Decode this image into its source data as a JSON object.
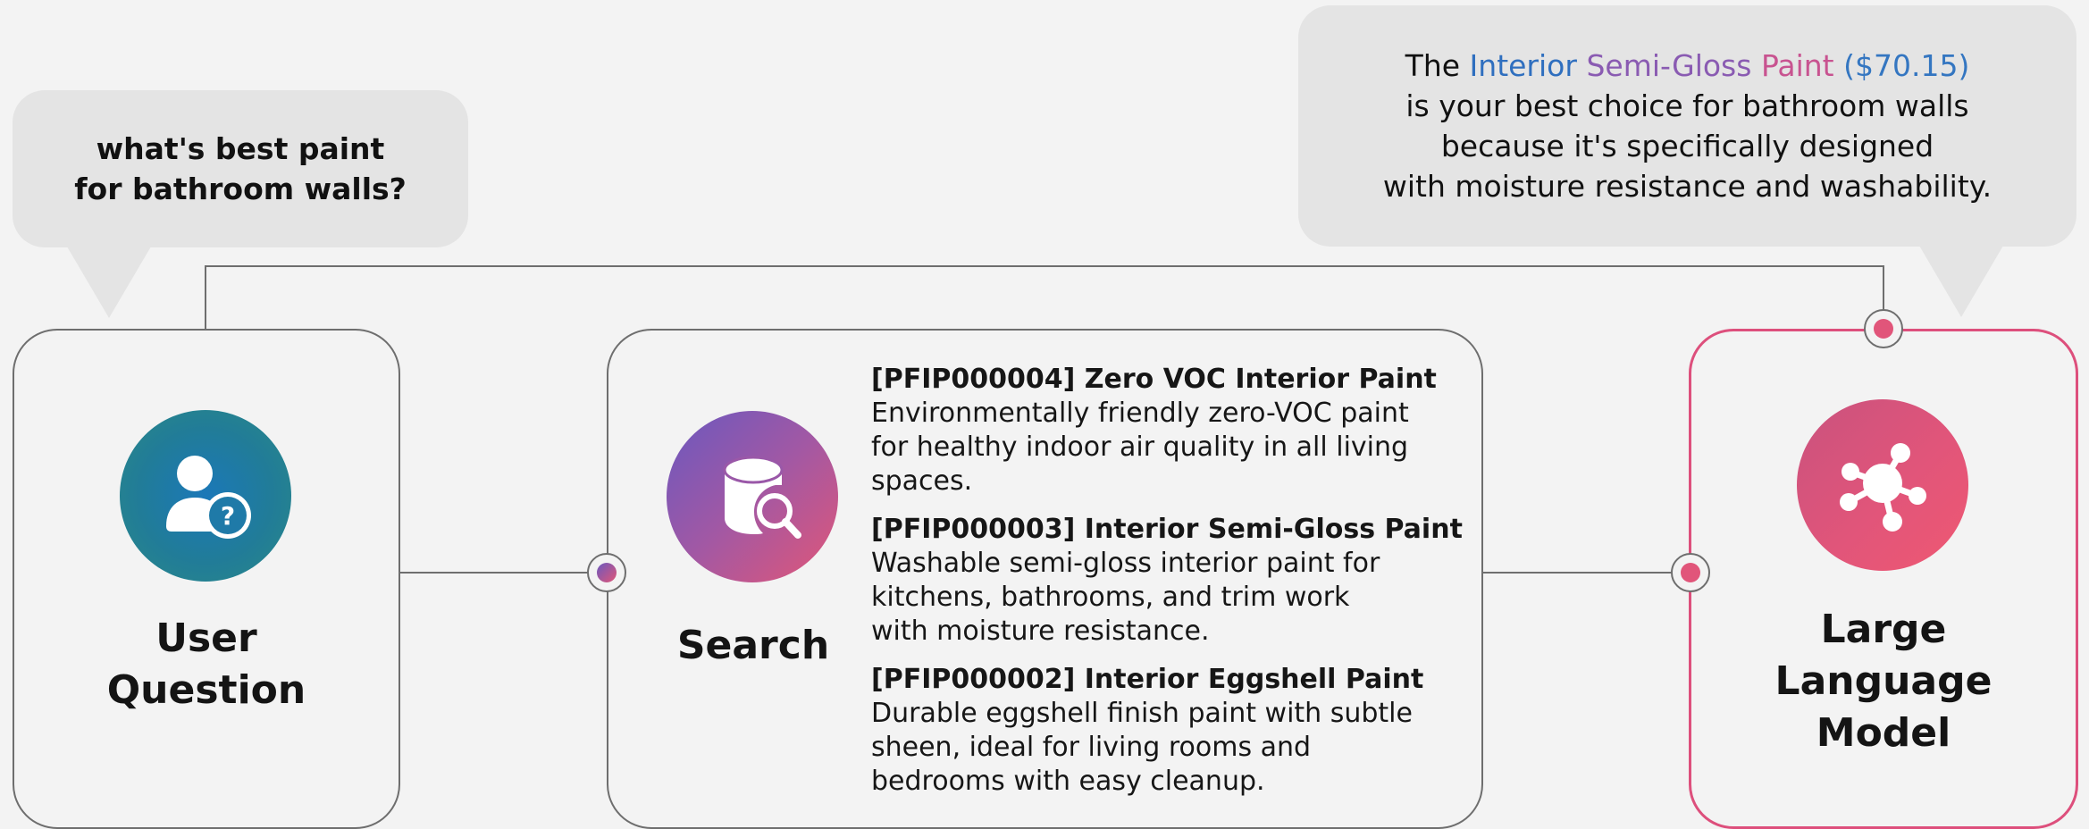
{
  "question_bubble": {
    "line1": "what's best paint",
    "line2": "for bathroom walls?"
  },
  "answer_bubble": {
    "prefix": "The",
    "w1": "Interior",
    "w2": "Semi-Gloss",
    "w3": "Paint",
    "price": "($70.15)",
    "line2": "is your best choice for bathroom walls",
    "line3": "because it's specifically designed",
    "line4": "with moisture resistance and washability."
  },
  "nodes": {
    "user": {
      "line1": "User",
      "line2": "Question",
      "icon": "user-question-icon"
    },
    "search": {
      "label": "Search",
      "icon": "database-search-icon"
    },
    "llm": {
      "line1": "Large",
      "line2": "Language",
      "line3": "Model",
      "icon": "network-hub-icon"
    }
  },
  "results": [
    {
      "title": "[PFIP000004] Zero VOC Interior Paint",
      "description": "Environmentally friendly zero-VOC paint for healthy indoor air quality in all living spaces."
    },
    {
      "title": "[PFIP000003] Interior Semi-Gloss Paint",
      "description": "Washable semi-gloss interior paint for kitchens, bathrooms, and trim work with moisture resistance."
    },
    {
      "title": "[PFIP000002] Interior Eggshell Paint",
      "description": "Durable eggshell finish paint with subtle sheen, ideal for living rooms and bedrooms with easy cleanup."
    }
  ],
  "colors": {
    "background": "#f3f3f3",
    "bubble": "#e4e4e4",
    "connector": "#6e6e6e",
    "llm_accent": "#dd4f7c",
    "user_icon": "#1f7aa8",
    "search_icon_start": "#6a58bf",
    "search_icon_end": "#e15677"
  }
}
